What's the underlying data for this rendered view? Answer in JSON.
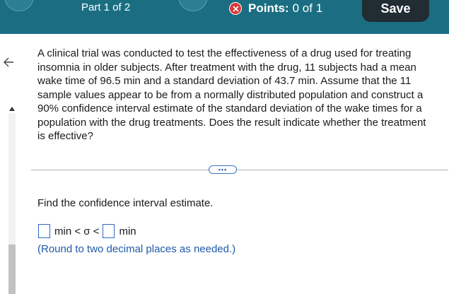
{
  "header": {
    "part_label": "Part 1 of 2",
    "points_label": "Points:",
    "points_value": "0 of 1",
    "save_label": "Save"
  },
  "question": {
    "text": "A clinical trial was conducted to test the effectiveness of a drug used for treating insomnia in older subjects. After treatment with the drug, 11 subjects had a mean wake time of 96.5 min and a standard deviation of 43.7 min. Assume that the 11 sample values appear to be from a normally distributed population and construct a 90% confidence interval estimate of the standard deviation of the wake times for a population with the drug treatments. Does the result indicate whether the treatment is effective?"
  },
  "more_label": "•••",
  "instruction": "Find the confidence interval estimate.",
  "answer": {
    "lower_value": "",
    "upper_value": "",
    "middle_text": "min < σ <",
    "unit": "min"
  },
  "round_note": "(Round to two decimal places as needed.)",
  "colors": {
    "header_bg": "#1b6e82",
    "save_bg": "#212c33",
    "x_icon": "#d93a3a",
    "link_blue": "#1f5aa8"
  }
}
